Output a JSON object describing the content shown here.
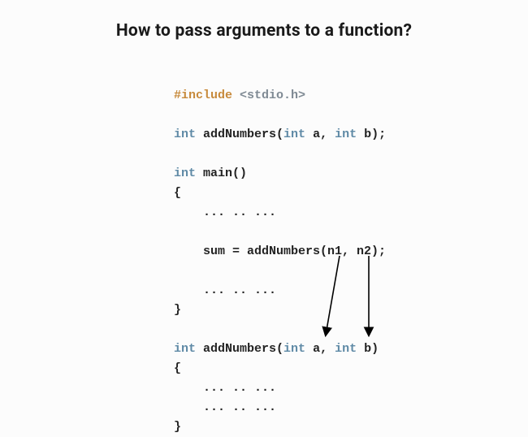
{
  "title": "How to pass arguments to a function?",
  "code": {
    "l1_preproc": "#include",
    "l1_header": "<stdio.h>",
    "l3_kw1": "int",
    "l3_fn": " addNumbers(",
    "l3_kw2": "int",
    "l3_a": " a, ",
    "l3_kw3": "int",
    "l3_b": " b);",
    "l5_kw": "int",
    "l5_rest": " main()",
    "l6": "{",
    "l7": "    ... .. ...",
    "l9": "    sum = addNumbers(n1, n2);",
    "l11": "    ... .. ...",
    "l12": "}",
    "l14_kw1": "int",
    "l14_fn": " addNumbers(",
    "l14_kw2": "int",
    "l14_a": " a, ",
    "l14_kw3": "int",
    "l14_b": " b)",
    "l15": "{",
    "l16": "    ... .. ...",
    "l17": "    ... .. ...",
    "l18": "}"
  }
}
